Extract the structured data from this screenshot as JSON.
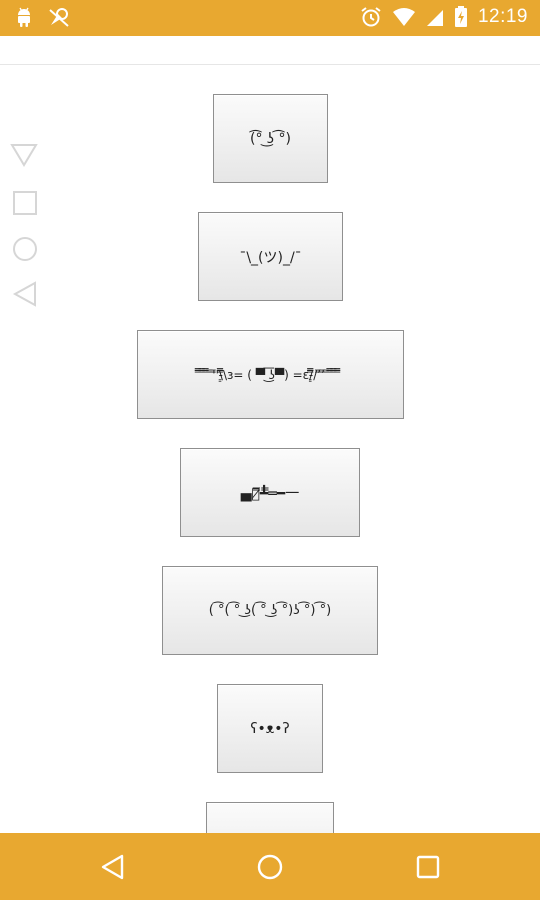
{
  "status_bar": {
    "time": "12:19",
    "left_icons": [
      "android-icon",
      "debug-icon"
    ],
    "right_icons": [
      "alarm-icon",
      "wifi-icon",
      "signal-icon",
      "battery-icon"
    ]
  },
  "side_nav": [
    "back-triangle-down-icon",
    "square-icon",
    "circle-icon",
    "back-triangle-left-icon"
  ],
  "buttons": [
    {
      "label": "(͡° ͜ʖ ͡°)"
    },
    {
      "label": "¯\\_(ツ)_/¯"
    },
    {
      "label": "̿̿ ̿̿ ̿̿ ̿'̿'\\̵͇̿̿\\з= ( ▀ ͜͞ʖ▀) =ε/̵͇̿̿/’̿’̿ ̿ ̿̿ ̿̿ ̿̿"
    },
    {
      "label": "▄︻̷̿┻̿═━一"
    },
    {
      "label": "( ͡°( ͡° ͜ʖ( ͡° ͜ʖ ͡°)ʖ ͡°) ͡°)"
    },
    {
      "label": "ʕ•ᴥ•ʔ"
    },
    {
      "label": ""
    }
  ],
  "colors": {
    "accent": "#e8a830"
  }
}
